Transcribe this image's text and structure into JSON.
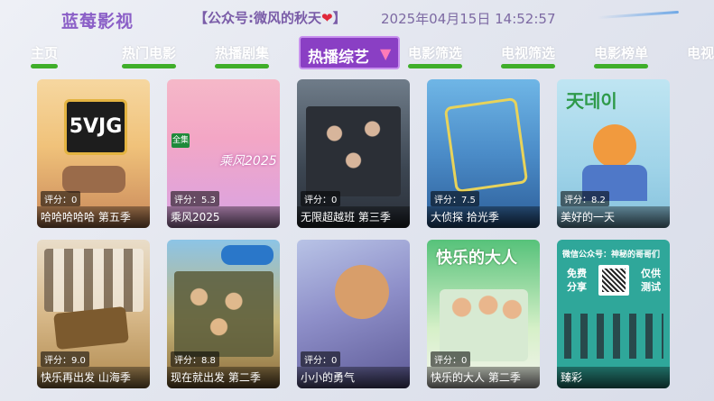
{
  "header": {
    "app_title": "蓝莓影视",
    "wechat_text": "【公众号:微风的秋天",
    "wechat_heart": "❤",
    "wechat_end": "】",
    "datetime": "2025年04月15日 14:52:57"
  },
  "nav": {
    "items": [
      "主页",
      "热门电影",
      "热播剧集",
      "热播综艺",
      "电影筛选",
      "电视筛选",
      "电影榜单",
      "电视"
    ],
    "active_label": "热播综艺",
    "active_icon": "filter-icon"
  },
  "cards": [
    {
      "title": "哈哈哈哈哈 第五季",
      "score": "评分：0"
    },
    {
      "title": "乘风2025",
      "score": "评分：5.3"
    },
    {
      "title": "无限超越班 第三季",
      "score": "评分：0"
    },
    {
      "title": "大侦探 拾光季",
      "score": "评分：7.5"
    },
    {
      "title": "美好的一天",
      "score": "评分：8.2"
    },
    {
      "title": "快乐再出发 山海季",
      "score": "评分：9.0"
    },
    {
      "title": "现在就出发 第二季",
      "score": "评分：8.8"
    },
    {
      "title": "小小的勇气",
      "score": "评分：0"
    },
    {
      "title": "快乐的大人 第二季",
      "score": "评分：0"
    },
    {
      "title": "臻彩",
      "score": ""
    }
  ],
  "poster_text": {
    "svjg": "5VJG",
    "chengfeng": "乘风2025",
    "quanji": "全集",
    "sheet": "天데이",
    "kuaile": "快乐的大人",
    "ad_title": "微信公众号：神秘的哥哥们",
    "ad_left": "免费分享",
    "ad_right": "仅供测试"
  },
  "colors": {
    "accent": "#8a3fc4",
    "nav_underline": "#3fae2a",
    "title": "#8b5fc7"
  }
}
